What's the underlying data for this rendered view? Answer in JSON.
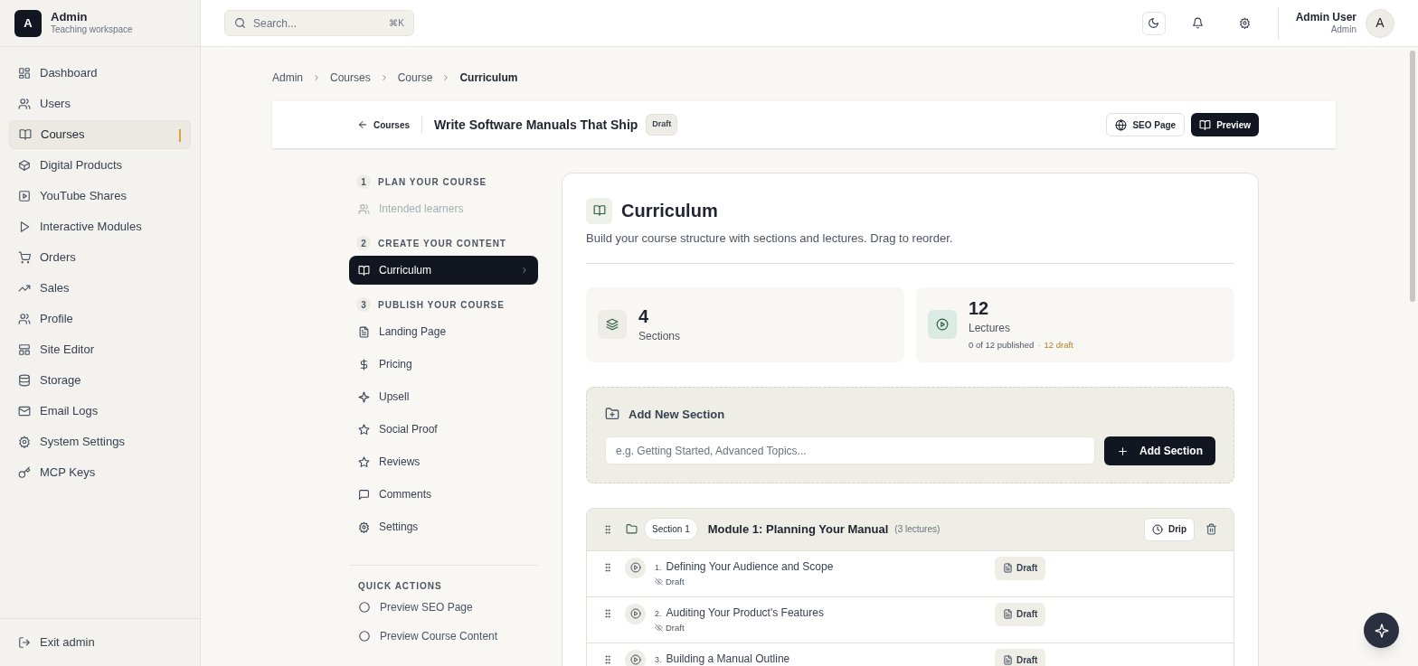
{
  "workspace": {
    "logo_letter": "A",
    "name": "Admin",
    "subtitle": "Teaching workspace"
  },
  "sidebar": {
    "items": [
      {
        "label": "Dashboard",
        "selected": false
      },
      {
        "label": "Users",
        "selected": false
      },
      {
        "label": "Courses",
        "selected": true
      },
      {
        "label": "Digital Products",
        "selected": false
      },
      {
        "label": "YouTube Shares",
        "selected": false
      },
      {
        "label": "Interactive Modules",
        "selected": false
      },
      {
        "label": "Orders",
        "selected": false
      },
      {
        "label": "Sales",
        "selected": false
      },
      {
        "label": "Profile",
        "selected": false
      },
      {
        "label": "Site Editor",
        "selected": false
      },
      {
        "label": "Storage",
        "selected": false
      },
      {
        "label": "Email Logs",
        "selected": false
      },
      {
        "label": "System Settings",
        "selected": false
      },
      {
        "label": "MCP Keys",
        "selected": false
      }
    ],
    "footer": "Exit admin"
  },
  "topbar": {
    "search": {
      "placeholder": "Search...",
      "shortcut": "⌘K"
    },
    "user": {
      "name": "Admin User",
      "role": "Admin",
      "avatar_letter": "A"
    }
  },
  "breadcrumb": [
    "Admin",
    "Courses",
    "Course",
    "Curriculum"
  ],
  "course_header": {
    "back": "Courses",
    "title": "Write Software Manuals That Ship",
    "status": "Draft",
    "buttons": [
      "SEO Page",
      "Preview"
    ]
  },
  "steps": [
    {
      "kind": "heading",
      "number": "1",
      "label": "PLAN YOUR COURSE"
    },
    {
      "kind": "item",
      "label": "Intended learners",
      "disabled": true,
      "selected": false
    },
    {
      "kind": "heading",
      "number": "2",
      "label": "CREATE YOUR CONTENT"
    },
    {
      "kind": "item",
      "label": "Curriculum",
      "disabled": false,
      "selected": true
    },
    {
      "kind": "heading",
      "number": "3",
      "label": "PUBLISH YOUR COURSE"
    },
    {
      "kind": "item",
      "label": "Landing Page",
      "disabled": false,
      "selected": false
    },
    {
      "kind": "item",
      "label": "Pricing",
      "disabled": false,
      "selected": false
    },
    {
      "kind": "item",
      "label": "Upsell",
      "disabled": false,
      "selected": false
    },
    {
      "kind": "item",
      "label": "Social Proof",
      "disabled": false,
      "selected": false
    },
    {
      "kind": "item",
      "label": "Reviews",
      "disabled": false,
      "selected": false
    },
    {
      "kind": "item",
      "label": "Comments",
      "disabled": false,
      "selected": false
    },
    {
      "kind": "item",
      "label": "Settings",
      "disabled": false,
      "selected": false
    }
  ],
  "quick_actions": {
    "title": "QUICK ACTIONS",
    "items": [
      "Preview SEO Page",
      "Preview Course Content"
    ]
  },
  "curriculum": {
    "title": "Curriculum",
    "description": "Build your course structure with sections and lectures. Drag to reorder.",
    "stats": [
      {
        "value": "4",
        "label": "Sections"
      },
      {
        "value": "12",
        "label": "Lectures",
        "detail": "0 of 12 published",
        "detail_separator": "·",
        "detail_highlight": "12 draft"
      }
    ],
    "add_section": {
      "title": "Add New Section",
      "placeholder": "e.g. Getting Started, Advanced Topics...",
      "button": "Add Section"
    },
    "sections": [
      {
        "badge": "Section 1",
        "title": "Module 1: Planning Your Manual",
        "count": "(3 lectures)",
        "drip_button": "Drip",
        "lectures": [
          {
            "number": "1.",
            "title": "Defining Your Audience and Scope",
            "status": "Draft",
            "button": "Draft"
          },
          {
            "number": "2.",
            "title": "Auditing Your Product's Features",
            "status": "Draft",
            "button": "Draft"
          },
          {
            "number": "3.",
            "title": "Building a Manual Outline",
            "button": "Draft"
          }
        ]
      }
    ]
  }
}
